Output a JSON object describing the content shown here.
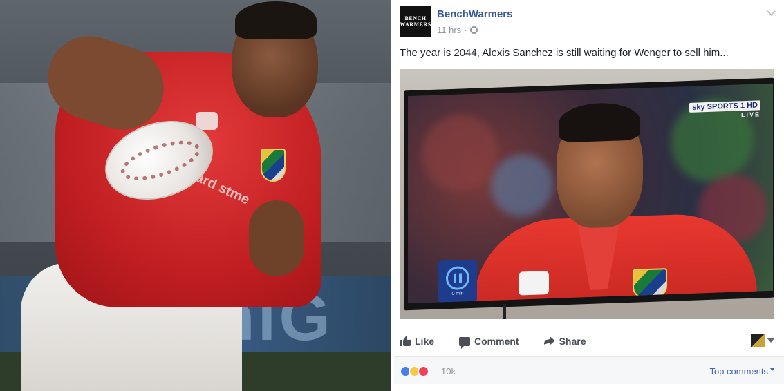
{
  "post": {
    "page_name": "BenchWarmers",
    "avatar_text": [
      "BENCH",
      "WARMERS"
    ],
    "time": "11 hrs",
    "text": "The year is 2044, Alexis Sanchez is still waiting for Wenger to sell him...",
    "media": {
      "badge": "sky SPORTS 1 HD",
      "live": "LIVE",
      "pause_label": "0 min"
    }
  },
  "actions": {
    "like": "Like",
    "comment": "Comment",
    "share": "Share"
  },
  "reactions": {
    "icons": [
      "like-icon",
      "haha-icon",
      "love-icon"
    ],
    "count": "10k",
    "sort_label": "Top comments"
  },
  "left_photo": {
    "shirt_text": "ard stme"
  },
  "colors": {
    "link_blue": "#365899",
    "jersey_red": "#c01e22",
    "muted_text": "#90949c"
  }
}
